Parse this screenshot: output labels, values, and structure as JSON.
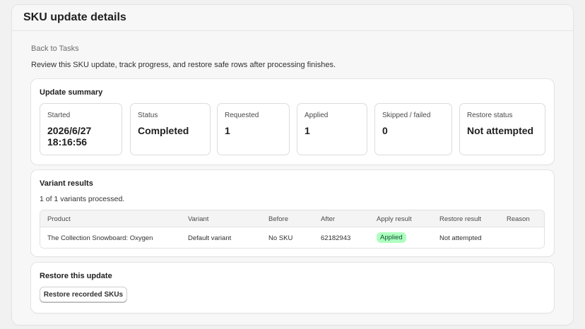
{
  "page": {
    "title": "SKU update details",
    "back_link": "Back to Tasks",
    "intro": "Review this SKU update, track progress, and restore safe rows after processing finishes."
  },
  "summary": {
    "title": "Update summary",
    "stats": [
      {
        "label": "Started",
        "value": "2026/6/27 18:16:56"
      },
      {
        "label": "Status",
        "value": "Completed"
      },
      {
        "label": "Requested",
        "value": "1"
      },
      {
        "label": "Applied",
        "value": "1"
      },
      {
        "label": "Skipped / failed",
        "value": "0"
      },
      {
        "label": "Restore status",
        "value": "Not attempted"
      }
    ]
  },
  "variants": {
    "title": "Variant results",
    "processed_text": "1 of 1 variants processed.",
    "columns": [
      "Product",
      "Variant",
      "Before",
      "After",
      "Apply result",
      "Restore result",
      "Reason"
    ],
    "rows": [
      {
        "product": "The Collection Snowboard: Oxygen",
        "variant": "Default variant",
        "before": "No SKU",
        "after": "62182943",
        "apply_result": "Applied",
        "restore_result": "Not attempted",
        "reason": ""
      }
    ]
  },
  "restore": {
    "title": "Restore this update",
    "button_label": "Restore recorded SKUs"
  },
  "colors": {
    "applied_badge_bg": "#affebf",
    "applied_badge_text": "#0c5132"
  }
}
